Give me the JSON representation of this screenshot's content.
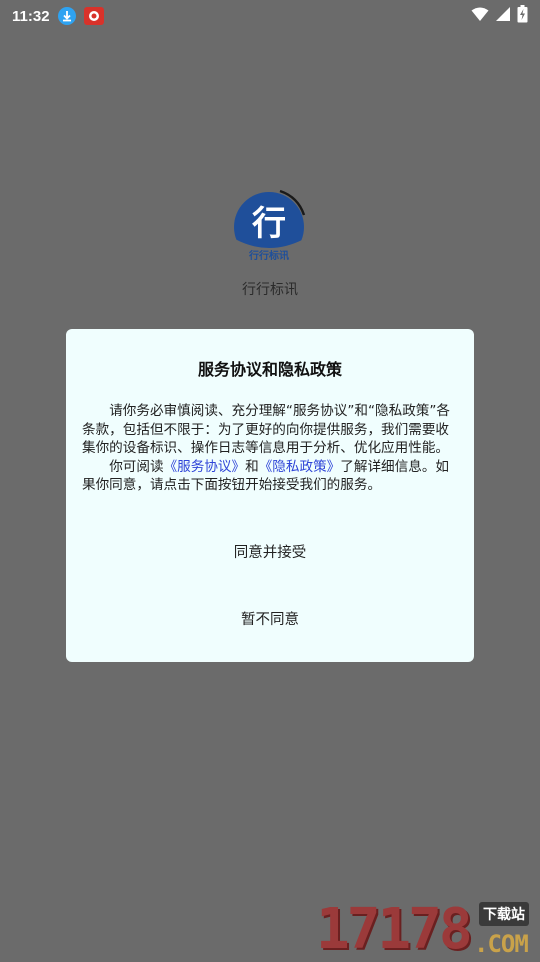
{
  "status_bar": {
    "time": "11:32",
    "icons": [
      "download-icon",
      "app-notification-icon",
      "wifi-icon",
      "signal-icon",
      "battery-charging-icon"
    ]
  },
  "splash": {
    "logo_char": "行",
    "logo_caption": "行行标讯",
    "app_name": "行行标讯"
  },
  "dialog": {
    "title": "服务协议和隐私政策",
    "paragraph1": "请你务必审慎阅读、充分理解“服务协议”和“隐私政策”各条款，包括但不限于：为了更好的向你提供服务，我们需要收集你的设备标识、操作日志等信息用于分析、优化应用性能。",
    "p2_before": "你可阅读",
    "link_service": "《服务协议》",
    "p2_and": "和",
    "link_privacy": "《隐私政策》",
    "p2_after": "了解详细信息。如果你同意，请点击下面按钮开始接受我们的服务。",
    "agree_button": "同意并接受",
    "decline_button": "暂不同意"
  },
  "watermark": {
    "digits": "17178",
    "tag": "下载站",
    "domain": ".COM"
  },
  "colors": {
    "overlay": "#6b6b6b",
    "dialog_bg": "#f0fefe",
    "link": "#2f45d8",
    "logo_blue": "#1f4f9a"
  }
}
